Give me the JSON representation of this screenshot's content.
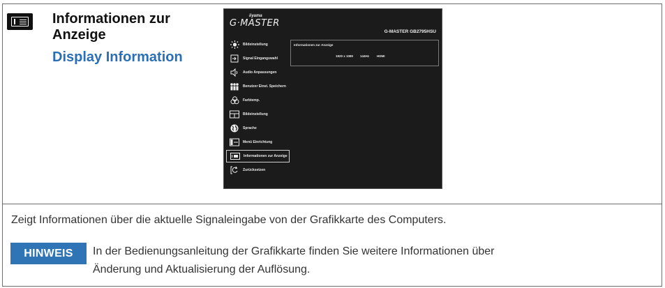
{
  "header": {
    "icon": "info-menu-icon",
    "title_de": "Informationen zur Anzeige",
    "title_en": "Display Information"
  },
  "osd": {
    "brand_small": "iiyama",
    "brand": "G·MASTER",
    "model": "G-MASTER GB2795HSU",
    "menu": [
      {
        "label": "Bildeinstellung",
        "icon": "sun-icon"
      },
      {
        "label": "Signal Eingangswahl",
        "icon": "input-icon"
      },
      {
        "label": "Audio Anpassungen",
        "icon": "speaker-icon"
      },
      {
        "label": "Benutzer Einst. Speichern",
        "icon": "users-icon"
      },
      {
        "label": "Farbtemp.",
        "icon": "color-icon"
      },
      {
        "label": "Bildeinstellung",
        "icon": "picture-icon"
      },
      {
        "label": "Sprache",
        "icon": "globe-icon"
      },
      {
        "label": "Menü Einrichtung",
        "icon": "menu-setup-icon"
      },
      {
        "label": "Informationen zur Anzeige",
        "icon": "info-icon"
      },
      {
        "label": "Zurücksetzen",
        "icon": "reset-icon"
      }
    ],
    "selected_index": 8,
    "panel": {
      "title": "Informationen zur Anzeige",
      "resolution": "1920 x 1080",
      "refresh": "144Hz",
      "input": "HDMI"
    }
  },
  "description": "Zeigt Informationen über die aktuelle Signaleingabe von der Grafikkarte des Computers.",
  "note": {
    "label": "HINWEIS",
    "line1": "In der Bedienungsanleitung der Grafikkarte finden Sie weitere Informationen über",
    "line2": "Änderung und Aktualisierung der Auflösung."
  }
}
